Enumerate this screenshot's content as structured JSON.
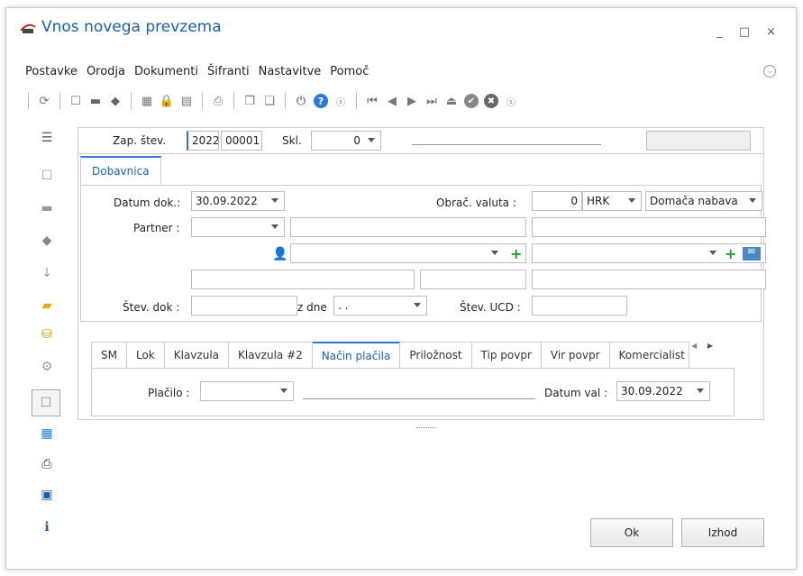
{
  "window": {
    "title": "Vnos novega prevzema",
    "controls": [
      "_",
      "□",
      "×"
    ]
  },
  "menu": {
    "items": [
      {
        "label": "Postavke"
      },
      {
        "label": "Orodja"
      },
      {
        "label": "Dokumenti"
      },
      {
        "label": "Šifranti"
      },
      {
        "label": "Nastavitve"
      },
      {
        "label": "Pomoč"
      }
    ]
  },
  "header": {
    "zap_label": "Zap. štev.",
    "zap_year": "2022",
    "zap_num": "00001",
    "skl_label": "Skl.",
    "skl_value": "0"
  },
  "tab": {
    "label": "Dobavnica"
  },
  "form": {
    "datum_label": "Datum dok.:",
    "datum_value": "30.09.2022",
    "valuta_label": "Obrač. valuta :",
    "valuta_rate": "0",
    "valuta_code": "HRK",
    "nabava_value": "Domača nabava",
    "partner_label": "Partner :",
    "stdok_label": "Štev. dok :",
    "zdne_label": "z dne",
    "zdne_value": ". .",
    "ucd_label": "Štev. UCD :"
  },
  "subtabs": [
    {
      "label": "SM"
    },
    {
      "label": "Lok"
    },
    {
      "label": "Klavzula"
    },
    {
      "label": "Klavzula #2"
    },
    {
      "label": "Način plačila"
    },
    {
      "label": "Priložnost"
    },
    {
      "label": "Tip povpr"
    },
    {
      "label": "Vir povpr"
    },
    {
      "label": "Komercialist"
    }
  ],
  "payment": {
    "placilo_label": "Plačilo :",
    "datum_val_label": "Datum val :",
    "datum_val_value": "30.09.2022"
  },
  "buttons": {
    "ok": "Ok",
    "exit": "Izhod"
  },
  "colors": {
    "accent": "#2a7ad6",
    "title": "#1a5fa8",
    "plus": "#1c9b2e"
  }
}
